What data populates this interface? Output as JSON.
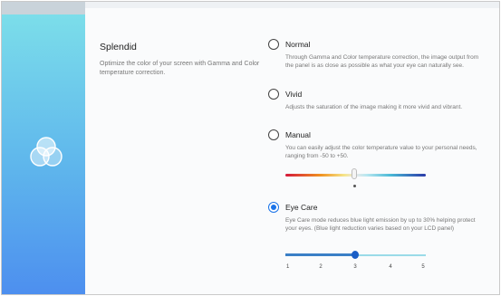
{
  "section": {
    "title": "Splendid",
    "description": "Optimize the color of your screen with Gamma and Color temperature correction."
  },
  "options": [
    {
      "label": "Normal",
      "description": "Through Gamma and Color temperature correction, the image output from the panel is as close as possible as what your eye can naturally see.",
      "selected": false
    },
    {
      "label": "Vivid",
      "description": "Adjusts the saturation of the image making it more vivid and vibrant.",
      "selected": false
    },
    {
      "label": "Manual",
      "description": "You can easily adjust the color temperature value to your personal needs, ranging from -50 to +50.",
      "selected": false
    },
    {
      "label": "Eye Care",
      "description": "Eye Care mode reduces blue light emission by up to 30% helping protect your eyes. (Blue light reduction varies based on your LCD panel)",
      "selected": true
    }
  ],
  "color_temperature_slider": {
    "min": -50,
    "max": 50,
    "value": 0
  },
  "eye_care_slider": {
    "ticks": [
      "1",
      "2",
      "3",
      "4",
      "5"
    ],
    "value": 3
  },
  "colors": {
    "accent": "#1a73e8",
    "sidebar_top": "#7ee1ea",
    "sidebar_bottom": "#4d8fef"
  },
  "icons": {
    "sidebar_logo": "splendid-circles-icon"
  }
}
